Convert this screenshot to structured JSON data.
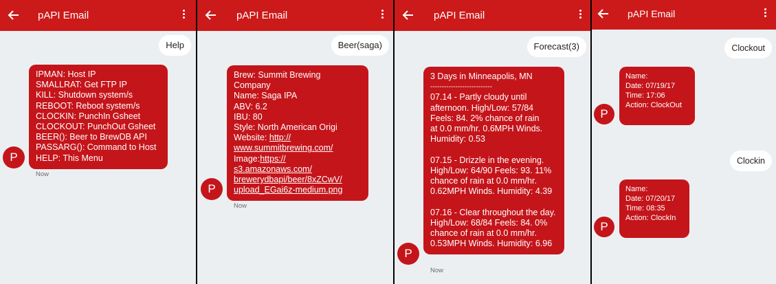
{
  "app_title": "pAPI Email",
  "colors": {
    "appbar": "#cc1a1a",
    "bubble_received": "#c4151b",
    "bubble_sent": "#ffffff",
    "background": "#eceff1"
  },
  "icons": {
    "back": "arrow-left-icon",
    "overflow": "more-vert-icon"
  },
  "screens": [
    {
      "sent": "Help",
      "avatar_letter": "P",
      "timestamp": "Now",
      "reply_lines": [
        "IPMAN: Host IP",
        "SMALLRAT: Get FTP IP",
        "KILL: Shutdown system/s",
        "REBOOT: Reboot system/s",
        "CLOCKIN: PunchIn Gsheet",
        "CLOCKOUT: PunchOut Gsheet",
        "BEER(): Beer to BrewDB API",
        "PASSARG(): Command to Host",
        "HELP: This Menu"
      ]
    },
    {
      "sent": "Beer(saga)",
      "avatar_letter": "P",
      "timestamp": "Now",
      "reply": {
        "brew_l1": "Brew: Summit Brewing",
        "brew_l2": "Company",
        "name": "Name: Saga IPA",
        "abv": "ABV: 6.2",
        "ibu": "IBU: 80",
        "style": "Style: North American Origi",
        "website_label": "Website: ",
        "website_l1": "http://",
        "website_l2": "www.summitbrewing.com",
        "website_suffix": "/",
        "image_label": "Image:",
        "image_l1": "https://",
        "image_l2": "s3.amazonaws.com/",
        "image_l3": "brewerydbapi/beer/8xZCwV/",
        "image_l4": "upload_EGai6z-medium.png"
      }
    },
    {
      "sent": "Forecast(3)",
      "avatar_letter": "P",
      "timestamp": "Now",
      "reply": {
        "header": "3 Days in Minneapolis, MN",
        "divider": "---------------------------",
        "day1": [
          "07.14 - Partly cloudy until",
          "afternoon. High/Low: 57/84",
          "Feels: 84. 2% chance of rain",
          "at 0.0 mm/hr. 0.6MPH Winds.",
          "Humidity: 0.53"
        ],
        "day2": [
          "07.15 - Drizzle in the evening.",
          "High/Low: 64/90 Feels: 93. 11%",
          "chance of rain at 0.0 mm/hr.",
          "0.62MPH Winds. Humidity: 4.39"
        ],
        "day3": [
          "07.16 - Clear throughout the day.",
          "High/Low: 68/84 Feels: 84. 0%",
          "chance of rain at 0.0 mm/hr.",
          "0.53MPH Winds. Humidity: 6.96"
        ]
      }
    },
    {
      "avatar_letter": "P",
      "conversation": [
        {
          "sent": "Clockout",
          "reply_lines": [
            "Name:",
            "Date: 07/19/17",
            "Time: 17:06",
            "Action: ClockOut"
          ]
        },
        {
          "sent": "Clockin",
          "reply_lines": [
            "Name:",
            "Date: 07/20/17",
            "Time: 08:35",
            "Action: ClockIn"
          ]
        }
      ]
    }
  ]
}
